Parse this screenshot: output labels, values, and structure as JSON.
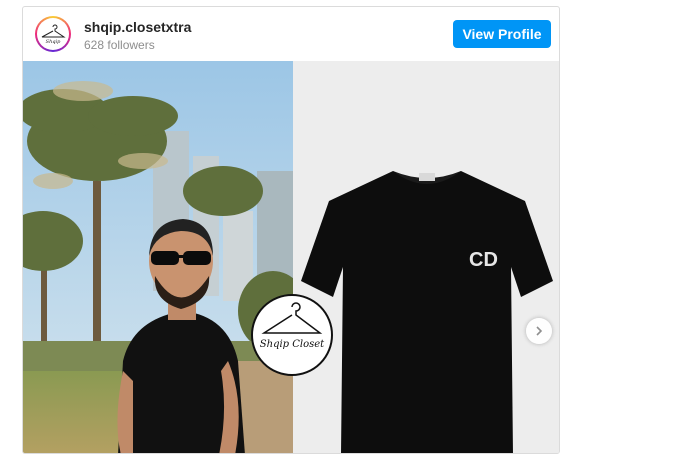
{
  "profile": {
    "username": "shqip.closetxtra",
    "followers": "628 followers",
    "view_profile_label": "View Profile"
  },
  "media": {
    "left_photo": "man in black t-shirt with sunglasses, palm trees",
    "right_photo": "black t-shirt with CD logo",
    "logo_text": "Shqip Closet",
    "tshirt_logo_text": "CD",
    "next_icon": "chevron-right-icon"
  },
  "colors": {
    "accent": "#0095f6",
    "username": "#262626",
    "muted": "#8e8e8e"
  }
}
